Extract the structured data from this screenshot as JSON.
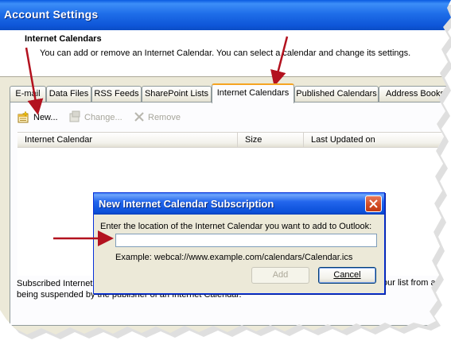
{
  "window": {
    "title": "Account Settings"
  },
  "section": {
    "title": "Internet Calendars",
    "description": "You can add or remove an Internet Calendar. You can select a calendar and change its settings."
  },
  "tabs": [
    {
      "label": "E-mail",
      "active": false
    },
    {
      "label": "Data Files",
      "active": false
    },
    {
      "label": "RSS Feeds",
      "active": false
    },
    {
      "label": "SharePoint Lists",
      "active": false
    },
    {
      "label": "Internet Calendars",
      "active": true
    },
    {
      "label": "Published Calendars",
      "active": false
    },
    {
      "label": "Address Books",
      "active": false
    }
  ],
  "toolbar": {
    "new_label": "New...",
    "change_label": "Change...",
    "remove_label": "Remove"
  },
  "list": {
    "columns": [
      "Internet Calendar",
      "Size",
      "Last Updated on"
    ],
    "rows": []
  },
  "bottom": {
    "line1": "Subscribed Internet",
    "line2": "being suspended by the publisher of an Internet Calendar.",
    "right": "our list from a"
  },
  "dialog": {
    "title": "New Internet Calendar Subscription",
    "prompt": "Enter the location of the Internet Calendar you want to add to Outlook:",
    "input_value": "",
    "example": "Example: webcal://www.example.com/calendars/Calendar.ics",
    "add_label": "Add",
    "cancel_label": "Cancel"
  },
  "colors": {
    "annotation_arrow": "#b3121f",
    "titlebar": "#0b55d6",
    "active_tab_accent": "#f5a422"
  }
}
